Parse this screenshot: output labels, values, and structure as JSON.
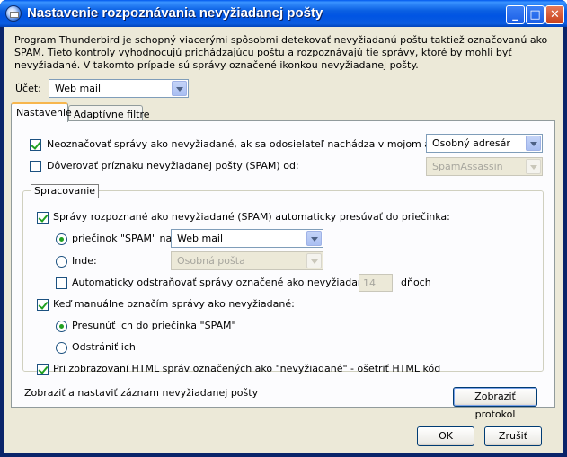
{
  "window": {
    "title": "Nastavenie rozpoznávania nevyžiadanej pošty",
    "controls": {
      "minimize": "_",
      "maximize": "□",
      "close": "✕"
    }
  },
  "intro": "Program Thunderbird je schopný viacerými spôsobmi detekovať nevyžiadanú poštu taktiež označovanú ako SPAM. Tieto kontroly vyhodnocujú prichádzajúcu poštu a rozpoznávajú tie správy, ktoré by mohli byť nevyžiadané. V takomto prípade sú správy označené ikonkou nevyžiadanej pošty.",
  "account": {
    "label": "Účet:",
    "value": "Web mail"
  },
  "tabs": [
    {
      "label": "Nastavenie",
      "active": true
    },
    {
      "label": "Adaptívne filtre",
      "active": false
    }
  ],
  "settings": {
    "whitelist": {
      "label": "Neoznačovať správy ako nevyžiadané, ak sa odosielateľ nachádza v mojom adresári:",
      "checked": true,
      "select": "Osobný adresár"
    },
    "trust": {
      "label": "Dôverovať príznaku nevyžiadanej pošty (SPAM) od:",
      "checked": false,
      "select": "SpamAssassin"
    }
  },
  "processing": {
    "legend": "Spracovanie",
    "move": {
      "label": "Správy rozpoznané ako nevyžiadané (SPAM) automaticky presúvať do priečinka:",
      "checked": true
    },
    "folder_spam": {
      "label": "priečinok \"SPAM\" na:",
      "selected": true,
      "select": "Web mail"
    },
    "other": {
      "label": "Inde:",
      "selected": false,
      "select": "Osobná pošta"
    },
    "purge": {
      "label": "Automaticky odstraňovať správy označené ako nevyžiadané po",
      "checked": false,
      "days": "14",
      "days_label": "dňoch"
    },
    "manual": {
      "label": "Keď manuálne označím správy ako nevyžiadané:",
      "checked": true
    },
    "manual_move": {
      "label": "Presunúť ich do priečinka \"SPAM\"",
      "selected": true
    },
    "manual_delete": {
      "label": "Odstrániť ich",
      "selected": false
    },
    "html": {
      "label": "Pri zobrazovaní HTML správ označených ako \"nevyžiadané\" - ošetriť HTML kód",
      "checked": true
    }
  },
  "log": {
    "label": "Zobraziť a nastaviť záznam nevyžiadanej pošty",
    "button": "Zobraziť protokol"
  },
  "footer": {
    "ok": "OK",
    "cancel": "Zrušiť"
  }
}
